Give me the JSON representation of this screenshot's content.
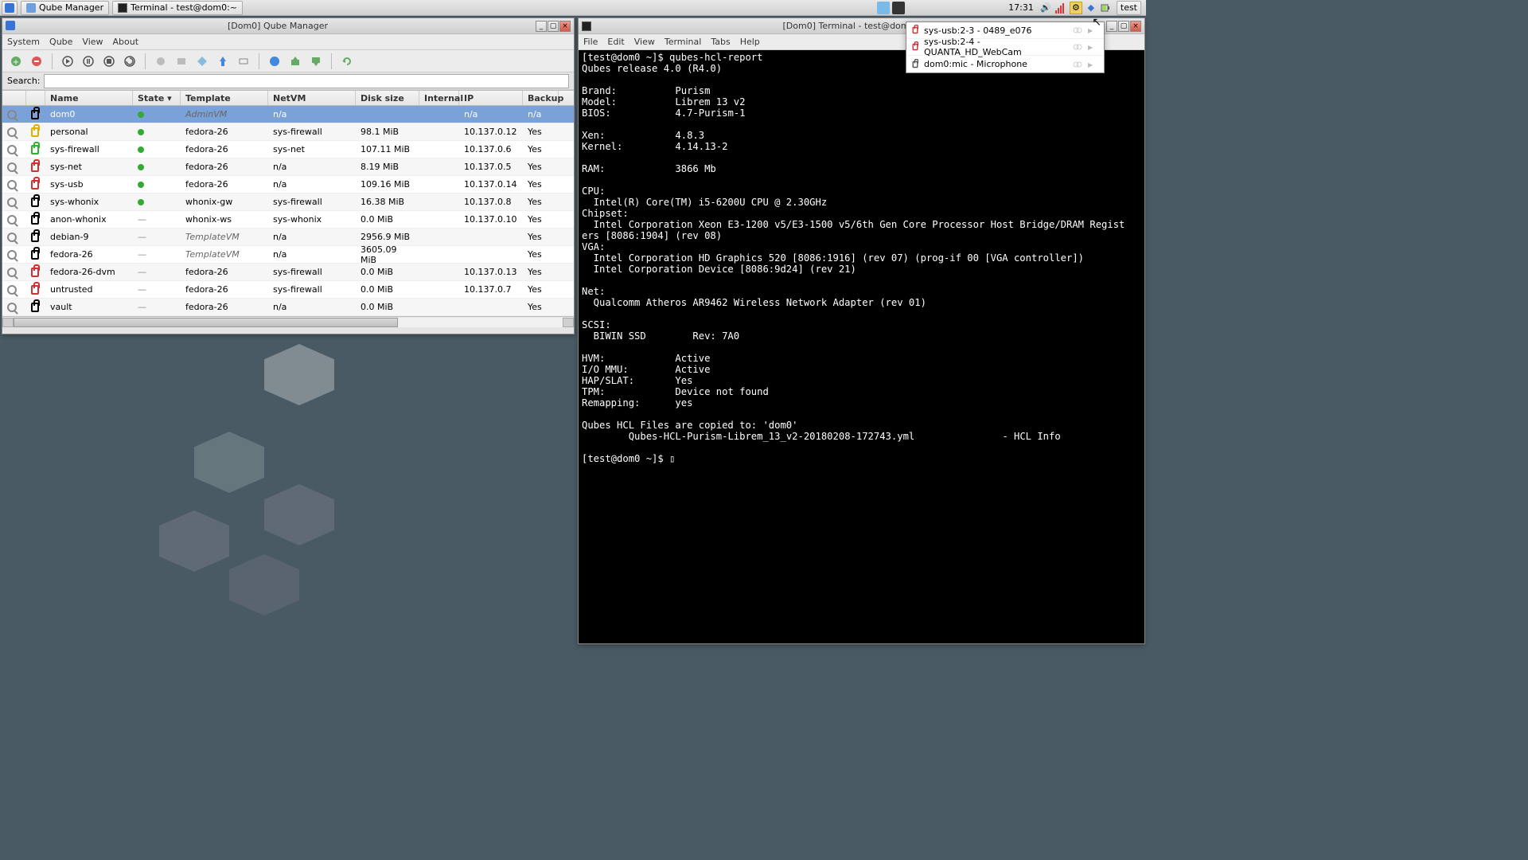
{
  "taskbar": {
    "apps": [
      {
        "id": "qubes-menu",
        "label": ""
      },
      {
        "id": "qube-manager",
        "label": "Qube Manager"
      },
      {
        "id": "terminal",
        "label": "Terminal - test@dom0:~"
      }
    ],
    "clock": "17:31",
    "user": "test"
  },
  "qm_window": {
    "title": "[Dom0] Qube Manager",
    "menus": [
      "System",
      "Qube",
      "View",
      "About"
    ],
    "search_label": "Search:",
    "columns": [
      "",
      "",
      "Name",
      "State ▾",
      "Template",
      "NetVM",
      "Disk size",
      "Internal",
      "IP",
      "Backup"
    ],
    "rows": [
      {
        "lock": "black",
        "name": "dom0",
        "state": "dot",
        "template": "AdminVM",
        "template_style": "italic",
        "netvm": "n/a",
        "disk": "",
        "internal": "",
        "ip": "n/a",
        "backup": "n/a",
        "selected": true,
        "cube": "#3874d8"
      },
      {
        "lock": "#e0b000",
        "name": "personal",
        "state": "dot",
        "template": "fedora-26",
        "netvm": "sys-firewall",
        "disk": "98.1 MiB",
        "internal": "",
        "ip": "10.137.0.12",
        "backup": "Yes",
        "cube": "#e0b000"
      },
      {
        "lock": "#30b030",
        "name": "sys-firewall",
        "state": "dot",
        "template": "fedora-26",
        "netvm": "sys-net",
        "disk": "107.11 MiB",
        "internal": "",
        "ip": "10.137.0.6",
        "backup": "Yes",
        "cube": "#30b030"
      },
      {
        "lock": "#d03030",
        "name": "sys-net",
        "state": "dot",
        "template": "fedora-26",
        "netvm": "n/a",
        "disk": "8.19 MiB",
        "internal": "",
        "ip": "10.137.0.5",
        "backup": "Yes",
        "cube": "#d03030"
      },
      {
        "lock": "#d03030",
        "name": "sys-usb",
        "state": "dot",
        "template": "fedora-26",
        "netvm": "n/a",
        "disk": "109.16 MiB",
        "internal": "",
        "ip": "10.137.0.14",
        "backup": "Yes",
        "cube": "#d03030"
      },
      {
        "lock": "black",
        "name": "sys-whonix",
        "state": "dot",
        "template": "whonix-gw",
        "netvm": "sys-firewall",
        "disk": "16.38 MiB",
        "internal": "",
        "ip": "10.137.0.8",
        "backup": "Yes",
        "cube": "#555"
      },
      {
        "lock": "black",
        "name": "anon-whonix",
        "state": "dash",
        "template": "whonix-ws",
        "netvm": "sys-whonix",
        "disk": "0.0 MiB",
        "internal": "",
        "ip": "10.137.0.10",
        "backup": "Yes",
        "cube": "#555"
      },
      {
        "lock": "black",
        "name": "debian-9",
        "state": "dash",
        "template": "TemplateVM",
        "template_style": "italic",
        "netvm": "n/a",
        "disk": "2956.9 MiB",
        "internal": "",
        "ip": "",
        "backup": "Yes",
        "cube": "#3874d8"
      },
      {
        "lock": "black",
        "name": "fedora-26",
        "state": "dash",
        "template": "TemplateVM",
        "template_style": "italic",
        "netvm": "n/a",
        "disk": "3605.09 MiB",
        "internal": "",
        "ip": "",
        "backup": "Yes",
        "cube": "#3874d8"
      },
      {
        "lock": "#d03030",
        "name": "fedora-26-dvm",
        "state": "dash",
        "template": "fedora-26",
        "netvm": "sys-firewall",
        "disk": "0.0 MiB",
        "internal": "",
        "ip": "10.137.0.13",
        "backup": "Yes",
        "cube": "#d03030"
      },
      {
        "lock": "#d03030",
        "name": "untrusted",
        "state": "dash",
        "template": "fedora-26",
        "netvm": "sys-firewall",
        "disk": "0.0 MiB",
        "internal": "",
        "ip": "10.137.0.7",
        "backup": "Yes",
        "cube": "#d03030"
      },
      {
        "lock": "black",
        "name": "vault",
        "state": "dash",
        "template": "fedora-26",
        "netvm": "n/a",
        "disk": "0.0 MiB",
        "internal": "",
        "ip": "",
        "backup": "Yes",
        "cube": "#555"
      }
    ]
  },
  "term_window": {
    "title": "[Dom0] Terminal - test@dom…",
    "menus": [
      "File",
      "Edit",
      "View",
      "Terminal",
      "Tabs",
      "Help"
    ],
    "content": "[test@dom0 ~]$ qubes-hcl-report\nQubes release 4.0 (R4.0)\n\nBrand:\t\tPurism\nModel:\t\tLibrem 13 v2\nBIOS:\t\t4.7-Purism-1\n\nXen:\t\t4.8.3\nKernel:\t\t4.14.13-2\n\nRAM:\t\t3866 Mb\n\nCPU:\n  Intel(R) Core(TM) i5-6200U CPU @ 2.30GHz\nChipset:\n  Intel Corporation Xeon E3-1200 v5/E3-1500 v5/6th Gen Core Processor Host Bridge/DRAM Regist\ners [8086:1904] (rev 08)\nVGA:\n  Intel Corporation HD Graphics 520 [8086:1916] (rev 07) (prog-if 00 [VGA controller])\n  Intel Corporation Device [8086:9d24] (rev 21)\n\nNet:\n  Qualcomm Atheros AR9462 Wireless Network Adapter (rev 01)\n\nSCSI:\n  BIWIN SSD        Rev: 7A0\n\nHVM:\t\tActive\nI/O MMU:\tActive\nHAP/SLAT:\tYes\nTPM:\t\tDevice not found\nRemapping:\tyes\n\nQubes HCL Files are copied to: 'dom0'\n\tQubes-HCL-Purism-Librem_13_v2-20180208-172743.yml\t\t- HCL Info\n\n[test@dom0 ~]$ ▯"
  },
  "device_popup": {
    "items": [
      {
        "color": "#d03030",
        "label": "sys-usb:2-3 - 0489_e076"
      },
      {
        "color": "#d03030",
        "label": "sys-usb:2-4 - QUANTA_HD_WebCam"
      },
      {
        "color": "#555",
        "label": "dom0:mic - Microphone"
      }
    ]
  }
}
